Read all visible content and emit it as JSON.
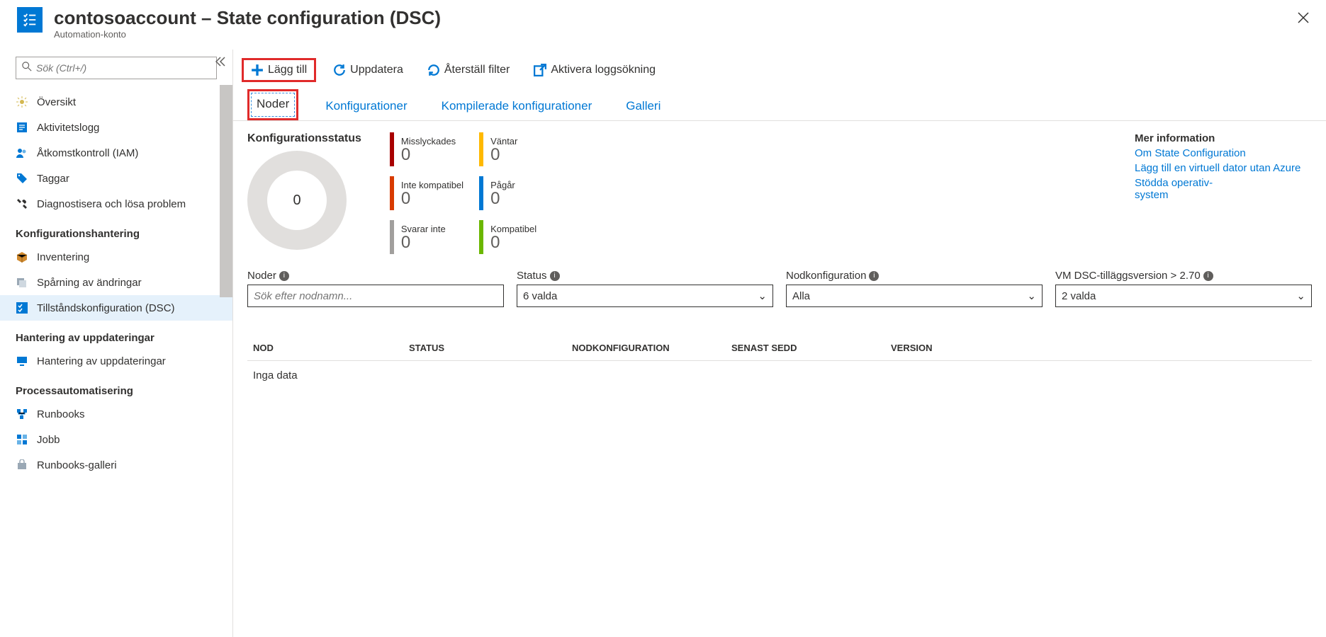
{
  "header": {
    "title": "contosoaccount – State configuration (DSC)",
    "subtitle": "Automation-konto"
  },
  "sidebar": {
    "search_placeholder": "Sök (Ctrl+/)",
    "items": [
      {
        "label": "Översikt",
        "icon": "gear-sparkle",
        "color": "#b9a142"
      },
      {
        "label": "Aktivitetslogg",
        "icon": "log",
        "color": "#0078d4"
      },
      {
        "label": "Åtkomstkontroll (IAM)",
        "icon": "people",
        "color": "#0078d4"
      },
      {
        "label": "Taggar",
        "icon": "tag",
        "color": "#0078d4"
      },
      {
        "label": "Diagnostisera och lösa problem",
        "icon": "wrench",
        "color": "#323130"
      }
    ],
    "group_config": "Konfigurationshantering",
    "config_items": [
      {
        "label": "Inventering",
        "icon": "box",
        "color": "#d18a2e"
      },
      {
        "label": "Spårning av ändringar",
        "icon": "stack",
        "color": "#7b8a9a"
      },
      {
        "label": "Tillståndskonfiguration (DSC)",
        "icon": "dsc",
        "color": "#0078d4",
        "active": true
      }
    ],
    "group_update": "Hantering av uppdateringar",
    "update_items": [
      {
        "label": "Hantering av uppdateringar",
        "icon": "monitor",
        "color": "#0078d4"
      }
    ],
    "group_process": "Processautomatisering",
    "process_items": [
      {
        "label": "Runbooks",
        "icon": "flow",
        "color": "#0078d4"
      },
      {
        "label": "Jobb",
        "icon": "grid",
        "color": "#0078d4"
      },
      {
        "label": "Runbooks-galleri",
        "icon": "bag",
        "color": "#7b8a9a"
      }
    ]
  },
  "toolbar": {
    "add": "Lägg till",
    "refresh": "Uppdatera",
    "reset": "Återställ filter",
    "log": "Aktivera loggsökning"
  },
  "tabs": {
    "nodes": "Noder",
    "configs": "Konfigurationer",
    "compiled": "Kompilerade konfigurationer",
    "gallery": "Galleri"
  },
  "status": {
    "title": "Konfigurationsstatus",
    "center": "0",
    "kpis_left": [
      {
        "label": "Misslyckades",
        "value": "0",
        "color": "#a80000"
      },
      {
        "label": "Inte kompatibel",
        "value": "0",
        "color": "#d83b01"
      },
      {
        "label": "Svarar inte",
        "value": "0",
        "color": "#a19f9d"
      }
    ],
    "kpis_right": [
      {
        "label": "Väntar",
        "value": "0",
        "color": "#ffb900"
      },
      {
        "label": "Pågår",
        "value": "0",
        "color": "#0078d4"
      },
      {
        "label": "Kompatibel",
        "value": "0",
        "color": "#6bb700"
      }
    ]
  },
  "moreinfo": {
    "header": "Mer information",
    "links": [
      "Om State Configuration",
      "Lägg till en virtuell dator utan Azure",
      "Stödda operativ-\nsystem"
    ]
  },
  "filters": {
    "nodes": {
      "label": "Noder",
      "placeholder": "Sök efter nodnamn..."
    },
    "status": {
      "label": "Status",
      "value": "6 valda"
    },
    "nodeconfig": {
      "label": "Nodkonfiguration",
      "value": "Alla"
    },
    "version": {
      "label": "VM DSC-tilläggsversion > 2.70",
      "value": "2 valda"
    }
  },
  "table": {
    "headers": [
      "NOD",
      "STATUS",
      "NODKONFIGURATION",
      "SENAST SEDD",
      "VERSION"
    ],
    "empty": "Inga data"
  },
  "chart_data": {
    "type": "pie",
    "title": "Konfigurationsstatus",
    "categories": [
      "Misslyckades",
      "Inte kompatibel",
      "Svarar inte",
      "Väntar",
      "Pågår",
      "Kompatibel"
    ],
    "values": [
      0,
      0,
      0,
      0,
      0,
      0
    ],
    "total": 0
  }
}
